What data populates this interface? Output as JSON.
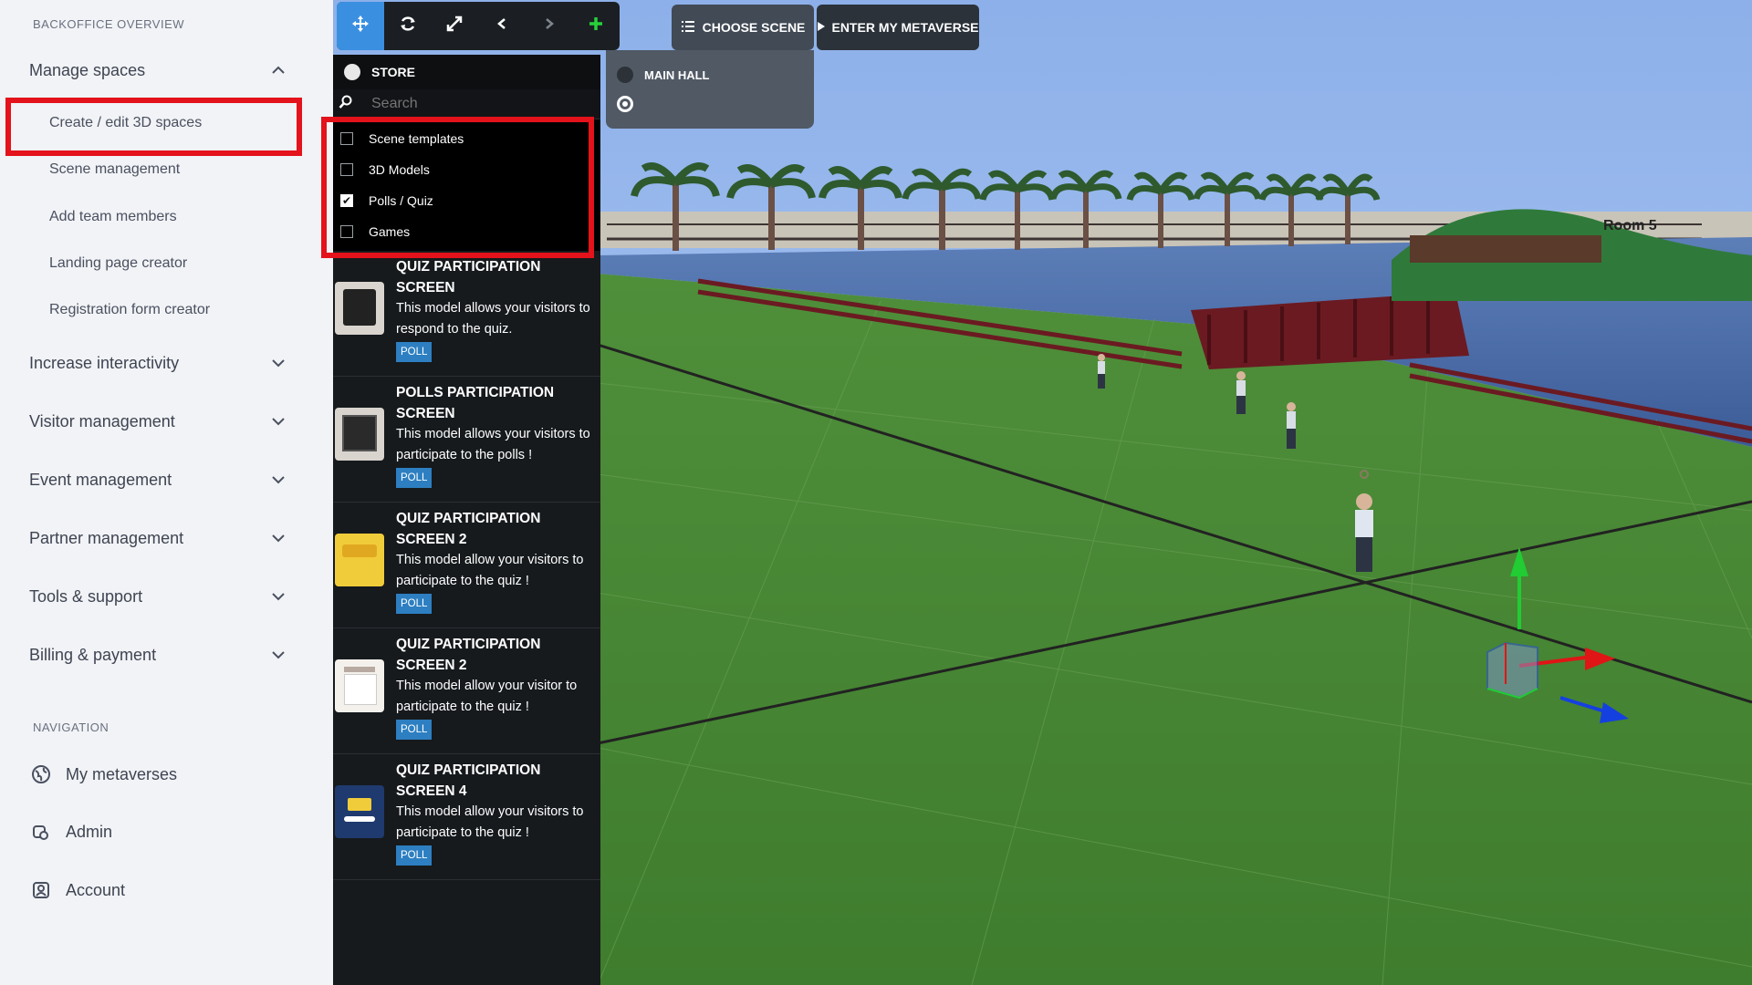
{
  "sidebar": {
    "section_overview": "BACKOFFICE OVERVIEW",
    "groups": [
      {
        "label": "Manage spaces",
        "expanded": true
      },
      {
        "label": "Increase interactivity"
      },
      {
        "label": "Visitor management"
      },
      {
        "label": "Event management"
      },
      {
        "label": "Partner management"
      },
      {
        "label": "Tools & support"
      },
      {
        "label": "Billing & payment"
      }
    ],
    "manage_spaces_items": [
      "Create / edit 3D spaces",
      "Scene management",
      "Add team members",
      "Landing page creator",
      "Registration form creator"
    ],
    "section_navigation": "NAVIGATION",
    "nav_links": [
      {
        "label": "My metaverses",
        "icon": "globe-icon"
      },
      {
        "label": "Admin",
        "icon": "admin-icon"
      },
      {
        "label": "Account",
        "icon": "account-icon"
      }
    ]
  },
  "toolbar": {
    "buttons": [
      "move-icon",
      "rotate-icon",
      "scale-icon",
      "chevron-left-icon",
      "chevron-right-icon",
      "plus-icon"
    ],
    "choose_scene": "CHOOSE SCENE",
    "enter_metaverse": "ENTER MY METAVERSE"
  },
  "scene_selector": {
    "options": [
      "MAIN HALL",
      ""
    ]
  },
  "store": {
    "title": "STORE",
    "search_placeholder": "Search",
    "filters": [
      {
        "label": "Scene templates",
        "checked": false
      },
      {
        "label": "3D Models",
        "checked": false
      },
      {
        "label": "Polls / Quiz",
        "checked": true
      },
      {
        "label": "Games",
        "checked": false
      }
    ],
    "items": [
      {
        "title": "QUIZ PARTICIPATION SCREEN",
        "desc": "This model allows your visitors to respond to the quiz.",
        "badge": "POLL"
      },
      {
        "title": "POLLS PARTICIPATION SCREEN",
        "desc": "This model allows your visitors to participate to the polls !",
        "badge": "POLL"
      },
      {
        "title": "QUIZ PARTICIPATION SCREEN 2",
        "desc": "This model allow your visitors to participate to the quiz !",
        "badge": "POLL"
      },
      {
        "title": "QUIZ PARTICIPATION SCREEN 2",
        "desc": "This model allow your visitor to participate to the quiz !",
        "badge": "POLL"
      },
      {
        "title": "QUIZ PARTICIPATION SCREEN 4",
        "desc": "This model allow your visitors to participate to the quiz !",
        "badge": "POLL"
      }
    ]
  },
  "scene": {
    "room_label": "Room 5"
  },
  "colors": {
    "highlight": "#e3121b",
    "accent": "#3b8fe0",
    "poll_badge": "#2d7fc1"
  }
}
